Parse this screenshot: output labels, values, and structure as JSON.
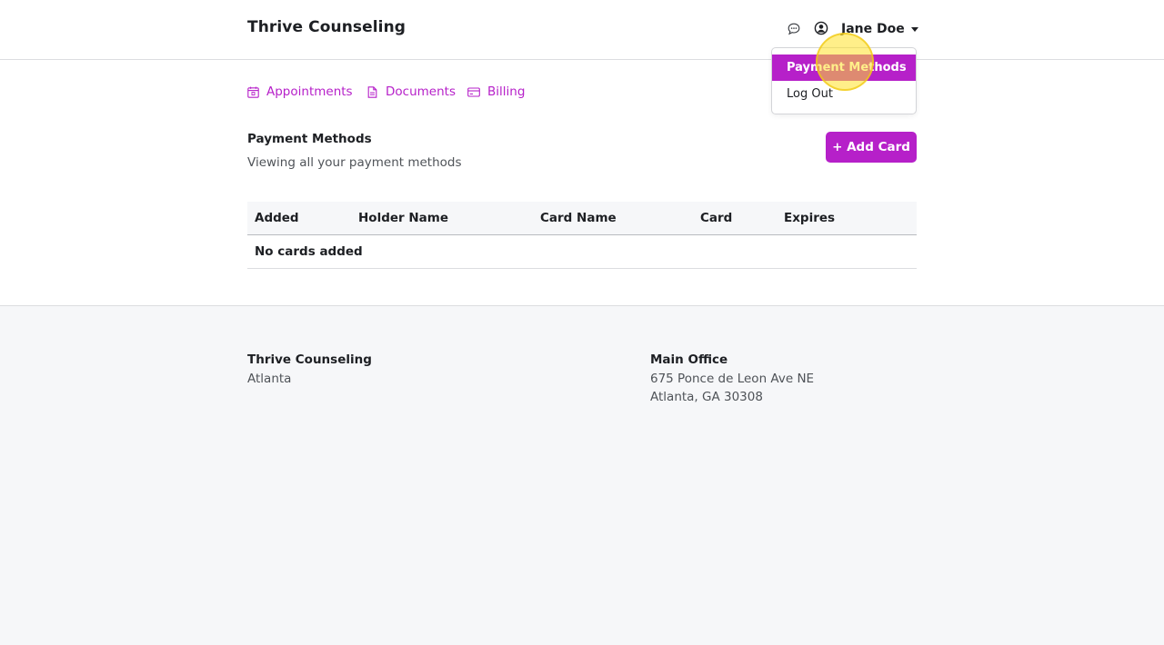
{
  "header": {
    "brand": "Thrive Counseling",
    "user_name": "Jane Doe",
    "icons": [
      "chat-icon",
      "user-circle-icon",
      "caret-down-icon"
    ]
  },
  "dropdown": {
    "items": [
      {
        "label": "Payment Methods",
        "state": "highlighted"
      },
      {
        "label": "Log Out"
      }
    ]
  },
  "nav": {
    "items": [
      {
        "label": "Appointments",
        "icon": "calendar-icon"
      },
      {
        "label": "Documents",
        "icon": "document-icon"
      },
      {
        "label": "Billing",
        "icon": "credit-card-icon"
      }
    ]
  },
  "section": {
    "title": "Payment Methods",
    "subtitle": "Viewing all your payment methods",
    "add_button": "+ Add Card"
  },
  "table": {
    "columns": [
      "Added",
      "Holder Name",
      "Card Name",
      "Card",
      "Expires"
    ],
    "empty_message": "No cards added"
  },
  "footer": {
    "org_name": "Thrive Counseling",
    "org_city": "Atlanta",
    "office_title": "Main Office",
    "office_address_line1": "675 Ponce de Leon Ave NE",
    "office_address_line2": "Atlanta, GA 30308"
  },
  "colors": {
    "accent": "#b620c9",
    "footer_bg": "#f6f7f9",
    "text": "#1d1f23",
    "muted_text": "#4f5358"
  }
}
